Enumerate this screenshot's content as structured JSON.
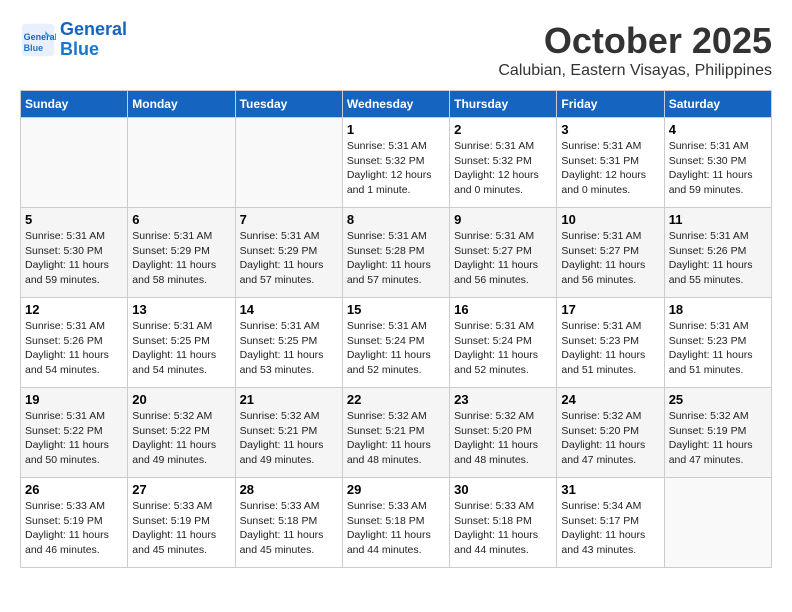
{
  "header": {
    "logo_line1": "General",
    "logo_line2": "Blue",
    "month": "October 2025",
    "location": "Calubian, Eastern Visayas, Philippines"
  },
  "weekdays": [
    "Sunday",
    "Monday",
    "Tuesday",
    "Wednesday",
    "Thursday",
    "Friday",
    "Saturday"
  ],
  "weeks": [
    [
      {
        "day": "",
        "info": ""
      },
      {
        "day": "",
        "info": ""
      },
      {
        "day": "",
        "info": ""
      },
      {
        "day": "1",
        "info": "Sunrise: 5:31 AM\nSunset: 5:32 PM\nDaylight: 12 hours\nand 1 minute."
      },
      {
        "day": "2",
        "info": "Sunrise: 5:31 AM\nSunset: 5:32 PM\nDaylight: 12 hours\nand 0 minutes."
      },
      {
        "day": "3",
        "info": "Sunrise: 5:31 AM\nSunset: 5:31 PM\nDaylight: 12 hours\nand 0 minutes."
      },
      {
        "day": "4",
        "info": "Sunrise: 5:31 AM\nSunset: 5:30 PM\nDaylight: 11 hours\nand 59 minutes."
      }
    ],
    [
      {
        "day": "5",
        "info": "Sunrise: 5:31 AM\nSunset: 5:30 PM\nDaylight: 11 hours\nand 59 minutes."
      },
      {
        "day": "6",
        "info": "Sunrise: 5:31 AM\nSunset: 5:29 PM\nDaylight: 11 hours\nand 58 minutes."
      },
      {
        "day": "7",
        "info": "Sunrise: 5:31 AM\nSunset: 5:29 PM\nDaylight: 11 hours\nand 57 minutes."
      },
      {
        "day": "8",
        "info": "Sunrise: 5:31 AM\nSunset: 5:28 PM\nDaylight: 11 hours\nand 57 minutes."
      },
      {
        "day": "9",
        "info": "Sunrise: 5:31 AM\nSunset: 5:27 PM\nDaylight: 11 hours\nand 56 minutes."
      },
      {
        "day": "10",
        "info": "Sunrise: 5:31 AM\nSunset: 5:27 PM\nDaylight: 11 hours\nand 56 minutes."
      },
      {
        "day": "11",
        "info": "Sunrise: 5:31 AM\nSunset: 5:26 PM\nDaylight: 11 hours\nand 55 minutes."
      }
    ],
    [
      {
        "day": "12",
        "info": "Sunrise: 5:31 AM\nSunset: 5:26 PM\nDaylight: 11 hours\nand 54 minutes."
      },
      {
        "day": "13",
        "info": "Sunrise: 5:31 AM\nSunset: 5:25 PM\nDaylight: 11 hours\nand 54 minutes."
      },
      {
        "day": "14",
        "info": "Sunrise: 5:31 AM\nSunset: 5:25 PM\nDaylight: 11 hours\nand 53 minutes."
      },
      {
        "day": "15",
        "info": "Sunrise: 5:31 AM\nSunset: 5:24 PM\nDaylight: 11 hours\nand 52 minutes."
      },
      {
        "day": "16",
        "info": "Sunrise: 5:31 AM\nSunset: 5:24 PM\nDaylight: 11 hours\nand 52 minutes."
      },
      {
        "day": "17",
        "info": "Sunrise: 5:31 AM\nSunset: 5:23 PM\nDaylight: 11 hours\nand 51 minutes."
      },
      {
        "day": "18",
        "info": "Sunrise: 5:31 AM\nSunset: 5:23 PM\nDaylight: 11 hours\nand 51 minutes."
      }
    ],
    [
      {
        "day": "19",
        "info": "Sunrise: 5:31 AM\nSunset: 5:22 PM\nDaylight: 11 hours\nand 50 minutes."
      },
      {
        "day": "20",
        "info": "Sunrise: 5:32 AM\nSunset: 5:22 PM\nDaylight: 11 hours\nand 49 minutes."
      },
      {
        "day": "21",
        "info": "Sunrise: 5:32 AM\nSunset: 5:21 PM\nDaylight: 11 hours\nand 49 minutes."
      },
      {
        "day": "22",
        "info": "Sunrise: 5:32 AM\nSunset: 5:21 PM\nDaylight: 11 hours\nand 48 minutes."
      },
      {
        "day": "23",
        "info": "Sunrise: 5:32 AM\nSunset: 5:20 PM\nDaylight: 11 hours\nand 48 minutes."
      },
      {
        "day": "24",
        "info": "Sunrise: 5:32 AM\nSunset: 5:20 PM\nDaylight: 11 hours\nand 47 minutes."
      },
      {
        "day": "25",
        "info": "Sunrise: 5:32 AM\nSunset: 5:19 PM\nDaylight: 11 hours\nand 47 minutes."
      }
    ],
    [
      {
        "day": "26",
        "info": "Sunrise: 5:33 AM\nSunset: 5:19 PM\nDaylight: 11 hours\nand 46 minutes."
      },
      {
        "day": "27",
        "info": "Sunrise: 5:33 AM\nSunset: 5:19 PM\nDaylight: 11 hours\nand 45 minutes."
      },
      {
        "day": "28",
        "info": "Sunrise: 5:33 AM\nSunset: 5:18 PM\nDaylight: 11 hours\nand 45 minutes."
      },
      {
        "day": "29",
        "info": "Sunrise: 5:33 AM\nSunset: 5:18 PM\nDaylight: 11 hours\nand 44 minutes."
      },
      {
        "day": "30",
        "info": "Sunrise: 5:33 AM\nSunset: 5:18 PM\nDaylight: 11 hours\nand 44 minutes."
      },
      {
        "day": "31",
        "info": "Sunrise: 5:34 AM\nSunset: 5:17 PM\nDaylight: 11 hours\nand 43 minutes."
      },
      {
        "day": "",
        "info": ""
      }
    ]
  ]
}
